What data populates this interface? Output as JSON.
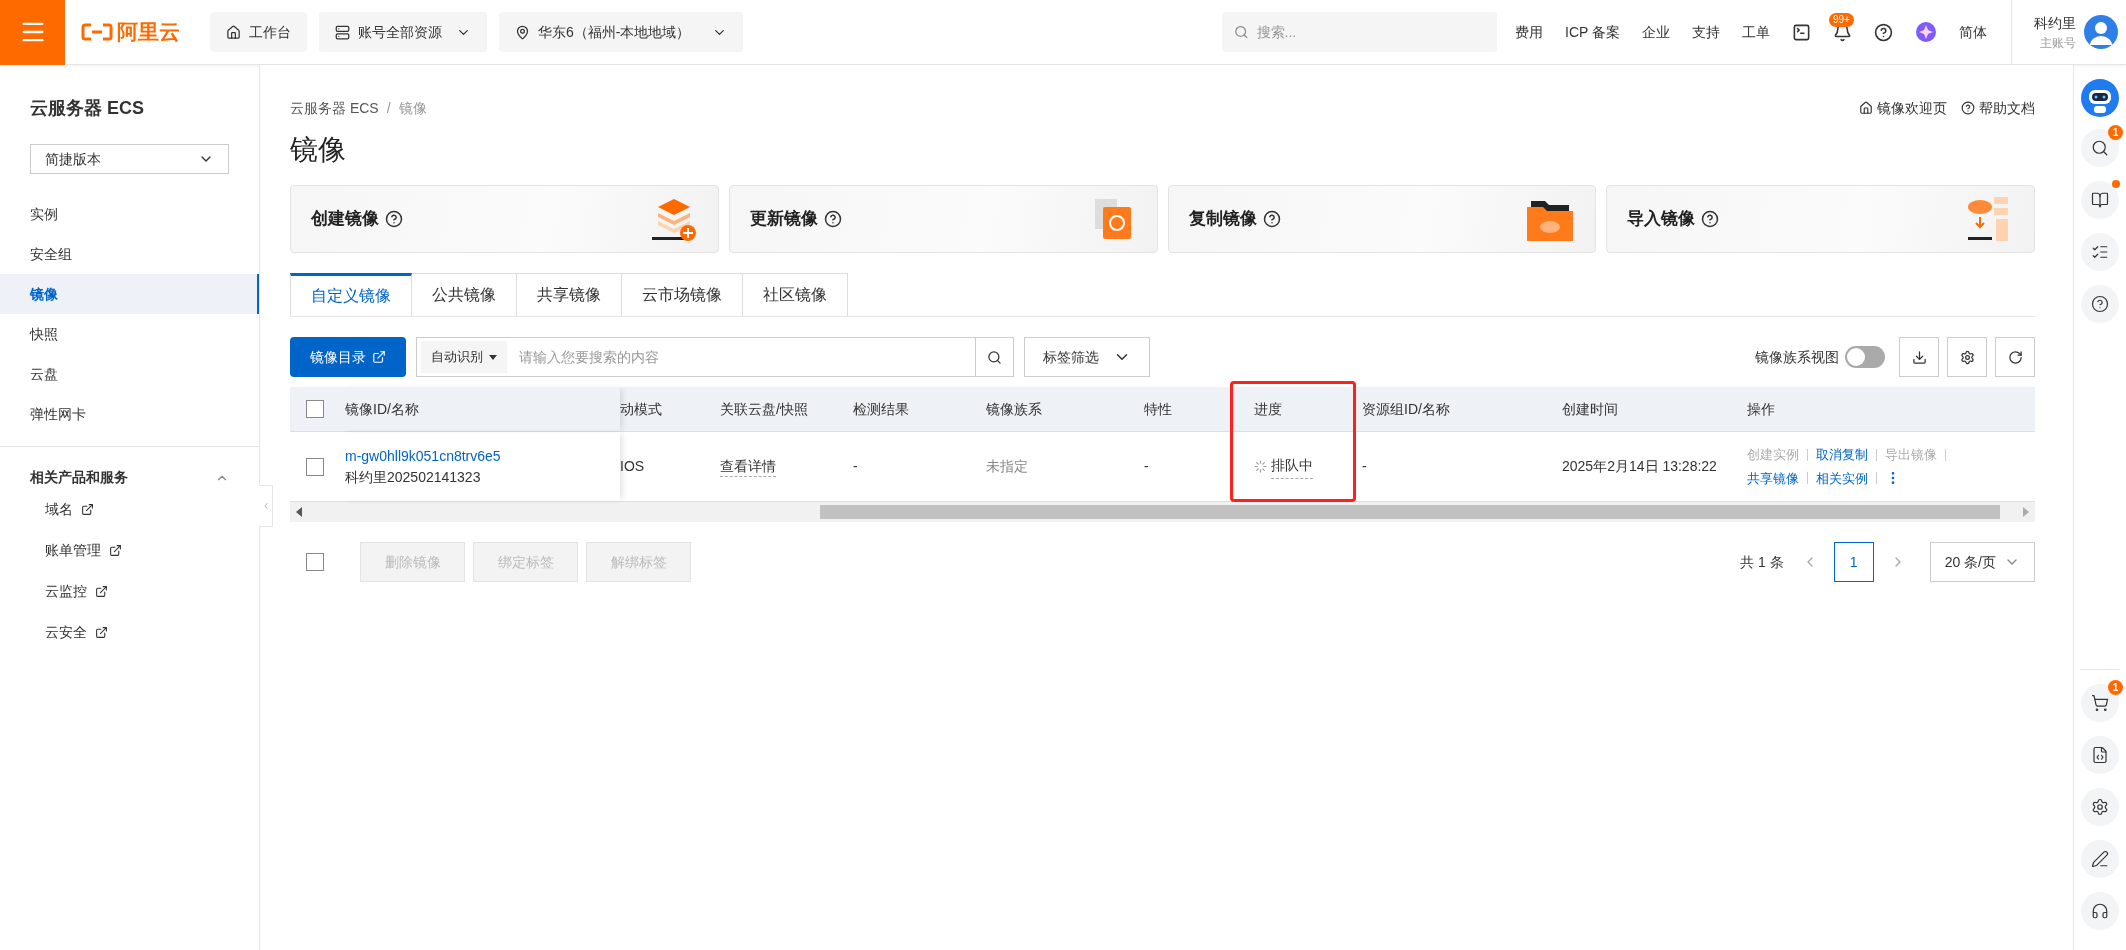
{
  "header": {
    "logo_text": "阿里云",
    "workbench": "工作台",
    "resources": "账号全部资源",
    "region": "华东6（福州-本地地域）",
    "search_placeholder": "搜索...",
    "links": [
      "费用",
      "ICP 备案",
      "企业",
      "支持",
      "工单"
    ],
    "notification_badge": "99+",
    "language": "简体",
    "user": {
      "name": "科约里",
      "role": "主账号"
    }
  },
  "sidebar": {
    "title": "云服务器 ECS",
    "version_select": "简捷版本",
    "items": [
      {
        "label": "实例",
        "selected": false
      },
      {
        "label": "安全组",
        "selected": false
      },
      {
        "label": "镜像",
        "selected": true
      },
      {
        "label": "快照",
        "selected": false
      },
      {
        "label": "云盘",
        "selected": false
      },
      {
        "label": "弹性网卡",
        "selected": false
      }
    ],
    "section": {
      "title": "相关产品和服务",
      "expanded": true,
      "links": [
        "域名",
        "账单管理",
        "云监控",
        "云安全"
      ]
    }
  },
  "breadcrumb": [
    "云服务器 ECS",
    "镜像"
  ],
  "breadcrumb_separator": "/",
  "top_links": [
    {
      "label": "镜像欢迎页",
      "kind": "home"
    },
    {
      "label": "帮助文档",
      "kind": "help"
    }
  ],
  "page_title": "镜像",
  "cards": [
    {
      "label": "创建镜像",
      "kind": "create"
    },
    {
      "label": "更新镜像",
      "kind": "update"
    },
    {
      "label": "复制镜像",
      "kind": "copy"
    },
    {
      "label": "导入镜像",
      "kind": "import"
    }
  ],
  "tabs": [
    {
      "label": "自定义镜像",
      "selected": true
    },
    {
      "label": "公共镜像",
      "selected": false
    },
    {
      "label": "共享镜像",
      "selected": false
    },
    {
      "label": "云市场镜像",
      "selected": false
    },
    {
      "label": "社区镜像",
      "selected": false
    }
  ],
  "toolbar": {
    "catalog_button": "镜像目录",
    "search_type": "自动识别",
    "search_placeholder": "请输入您要搜索的内容",
    "tag_filter": "标签筛选",
    "family_view": {
      "label": "镜像族系视图",
      "on": false
    }
  },
  "table": {
    "header_checked": false,
    "columns": [
      {
        "label": "镜像ID/名称",
        "highlighted": false
      },
      {
        "label": "动模式",
        "highlighted": false
      },
      {
        "label": "关联云盘/快照",
        "highlighted": false
      },
      {
        "label": "检测结果",
        "highlighted": false
      },
      {
        "label": "镜像族系",
        "highlighted": false
      },
      {
        "label": "特性",
        "highlighted": false
      },
      {
        "label": "进度",
        "highlighted": true
      },
      {
        "label": "资源组ID/名称",
        "highlighted": false
      },
      {
        "label": "创建时间",
        "highlighted": false
      },
      {
        "label": "操作",
        "highlighted": false
      }
    ],
    "rows": [
      {
        "checked": false,
        "id": "m-gw0hll9k051cn8trv6e5",
        "name": "科约里202502141323",
        "boot_mode": "IOS",
        "disk": "查看详情",
        "check_result": "-",
        "family": "未指定",
        "feature": "-",
        "progress": "排队中",
        "resource_group": "-",
        "created": "2025年2月14日 13:28:22",
        "actions": [
          {
            "label": "创建实例",
            "disabled": true
          },
          {
            "label": "取消复制",
            "disabled": false
          },
          {
            "label": "导出镜像",
            "disabled": true
          },
          {
            "label": "共享镜像",
            "disabled": false
          },
          {
            "label": "相关实例",
            "disabled": false
          }
        ]
      }
    ]
  },
  "bulk_actions": {
    "checked": false,
    "buttons": [
      {
        "label": "删除镜像",
        "disabled": true
      },
      {
        "label": "绑定标签",
        "disabled": true
      },
      {
        "label": "解绑标签",
        "disabled": true
      }
    ]
  },
  "pagination": {
    "total": "共 1 条",
    "pages": [
      {
        "label": "1",
        "selected": true
      }
    ],
    "page_size": "20 条/页"
  },
  "right_rail": {
    "top": [
      {
        "kind": "search",
        "badge": "1",
        "dot": false
      },
      {
        "kind": "book",
        "dot": true
      },
      {
        "kind": "checklist",
        "dot": false
      },
      {
        "kind": "help",
        "dot": false
      }
    ],
    "bottom": [
      {
        "kind": "cart",
        "badge": "1",
        "dot": false
      },
      {
        "kind": "api",
        "dot": false
      },
      {
        "kind": "settings",
        "dot": false
      },
      {
        "kind": "edit",
        "dot": false
      },
      {
        "kind": "support",
        "dot": false
      }
    ]
  }
}
